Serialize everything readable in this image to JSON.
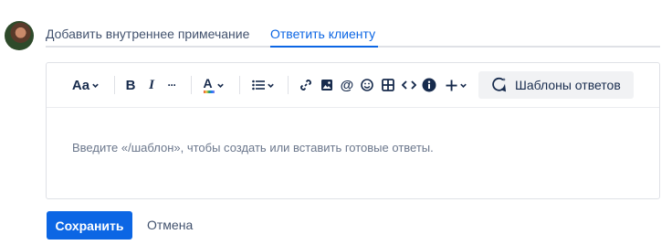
{
  "tabs": {
    "internal_note": "Добавить внутреннее примечание",
    "reply_customer": "Ответить клиенту"
  },
  "toolbar": {
    "text_style": "Aa",
    "bold": "B",
    "italic": "I",
    "more_formatting": "···",
    "text_color": "A",
    "templates_button": "Шаблоны ответов"
  },
  "editor": {
    "placeholder": "Введите «/шаблон», чтобы создать или вставить готовые ответы."
  },
  "actions": {
    "save": "Сохранить",
    "cancel": "Отмена"
  },
  "colors": {
    "accent": "#0c66e4",
    "text": "#172b4d",
    "muted": "#42526e"
  }
}
